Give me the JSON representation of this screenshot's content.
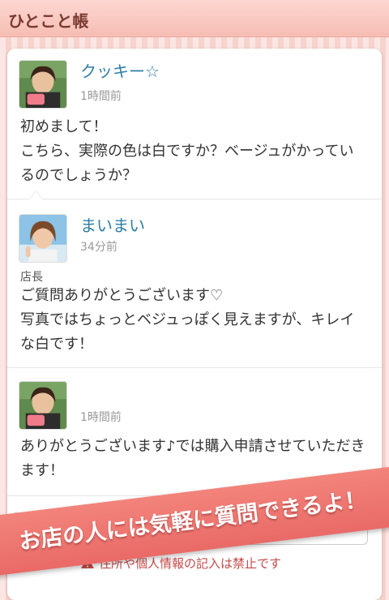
{
  "header": {
    "title": "ひとこと帳"
  },
  "comments": [
    {
      "name": "クッキー☆",
      "time": "1時間前",
      "text": "初めまして！\nこちら、実際の色は白ですか？ベージュがかっているのでしょうか？"
    },
    {
      "name": "まいまい",
      "time": "34分前",
      "role": "店長",
      "text": "ご質問ありがとうございます♡\n写真ではちょっとベジュっぽく見えますが、キレイな白です！"
    },
    {
      "name": "",
      "time": "1時間前",
      "text": "ありがとうございます♪では購入申請させていただきます！"
    }
  ],
  "footer": {
    "warning": "住所や個人情報の記入は禁止です"
  },
  "banner": {
    "text": "お店の人には気軽に質問できるよ！"
  },
  "colors": {
    "accent": "#e96a67",
    "name": "#2f7fa6",
    "header_bg": "#f6bdb4"
  }
}
